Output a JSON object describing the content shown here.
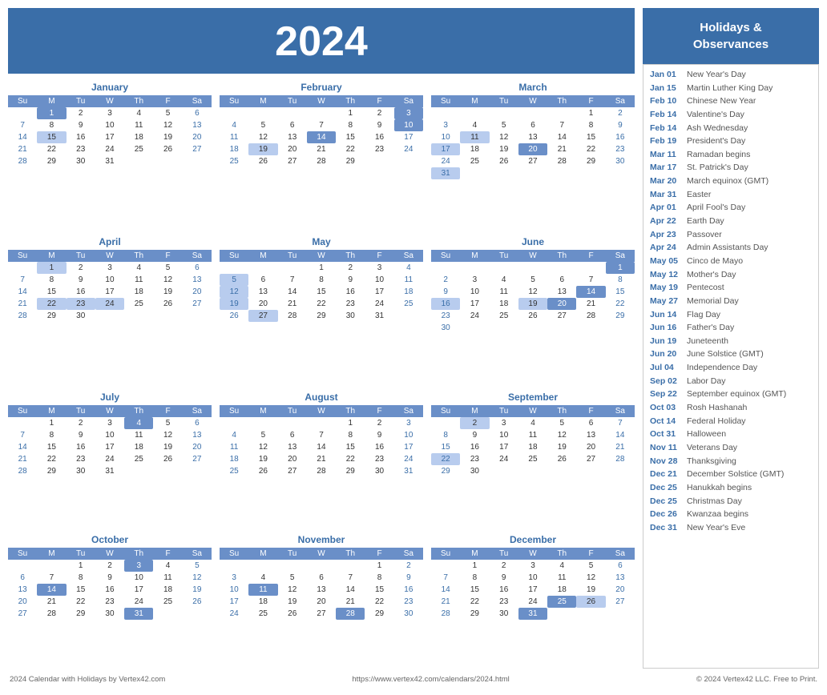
{
  "year": "2024",
  "title": "2024 Calendar with Holidays by Vertex42.com",
  "url": "https://www.vertex42.com/calendars/2024.html",
  "copyright": "© 2024 Vertex42 LLC. Free to Print.",
  "holidaysHeader": "Holidays &\nObservances",
  "dayHeaders": [
    "Su",
    "M",
    "Tu",
    "W",
    "Th",
    "F",
    "Sa"
  ],
  "holidays": [
    {
      "date": "Jan 01",
      "name": "New Year's Day"
    },
    {
      "date": "Jan 15",
      "name": "Martin Luther King Day"
    },
    {
      "date": "Feb 10",
      "name": "Chinese New Year"
    },
    {
      "date": "Feb 14",
      "name": "Valentine's Day"
    },
    {
      "date": "Feb 14",
      "name": "Ash Wednesday"
    },
    {
      "date": "Feb 19",
      "name": "President's Day"
    },
    {
      "date": "Mar 11",
      "name": "Ramadan begins"
    },
    {
      "date": "Mar 17",
      "name": "St. Patrick's Day"
    },
    {
      "date": "Mar 20",
      "name": "March equinox (GMT)"
    },
    {
      "date": "Mar 31",
      "name": "Easter"
    },
    {
      "date": "Apr 01",
      "name": "April Fool's Day"
    },
    {
      "date": "Apr 22",
      "name": "Earth Day"
    },
    {
      "date": "Apr 23",
      "name": "Passover"
    },
    {
      "date": "Apr 24",
      "name": "Admin Assistants Day"
    },
    {
      "date": "May 05",
      "name": "Cinco de Mayo"
    },
    {
      "date": "May 12",
      "name": "Mother's Day"
    },
    {
      "date": "May 19",
      "name": "Pentecost"
    },
    {
      "date": "May 27",
      "name": "Memorial Day"
    },
    {
      "date": "Jun 14",
      "name": "Flag Day"
    },
    {
      "date": "Jun 16",
      "name": "Father's Day"
    },
    {
      "date": "Jun 19",
      "name": "Juneteenth"
    },
    {
      "date": "Jun 20",
      "name": "June Solstice (GMT)"
    },
    {
      "date": "Jul 04",
      "name": "Independence Day"
    },
    {
      "date": "Sep 02",
      "name": "Labor Day"
    },
    {
      "date": "Sep 22",
      "name": "September equinox (GMT)"
    },
    {
      "date": "Oct 03",
      "name": "Rosh Hashanah"
    },
    {
      "date": "Oct 14",
      "name": "Federal Holiday"
    },
    {
      "date": "Oct 31",
      "name": "Halloween"
    },
    {
      "date": "Nov 11",
      "name": "Veterans Day"
    },
    {
      "date": "Nov 28",
      "name": "Thanksgiving"
    },
    {
      "date": "Dec 21",
      "name": "December Solstice (GMT)"
    },
    {
      "date": "Dec 25",
      "name": "Hanukkah begins"
    },
    {
      "date": "Dec 25",
      "name": "Christmas Day"
    },
    {
      "date": "Dec 26",
      "name": "Kwanzaa begins"
    },
    {
      "date": "Dec 31",
      "name": "New Year's Eve"
    }
  ]
}
